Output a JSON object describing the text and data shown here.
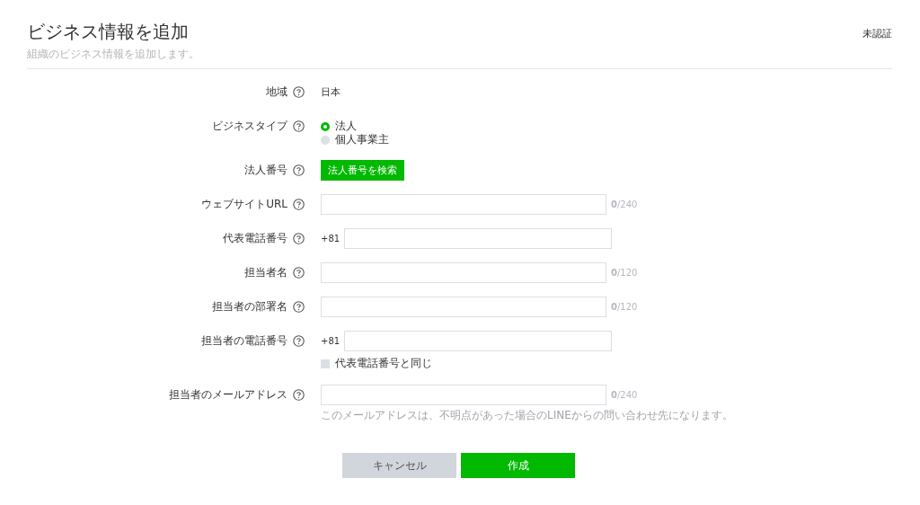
{
  "header": {
    "title": "ビジネス情報を追加",
    "subtitle": "組織のビジネス情報を追加します。",
    "status": "未認証"
  },
  "fields": [
    {
      "kind": "text",
      "label": "地域",
      "value": "日本"
    },
    {
      "kind": "radio",
      "label": "ビジネスタイプ",
      "options": [
        {
          "label": "法人",
          "selected": true
        },
        {
          "label": "個人事業主",
          "selected": false
        }
      ]
    },
    {
      "kind": "button",
      "label": "法人番号",
      "button": "法人番号を検索"
    },
    {
      "kind": "input",
      "label": "ウェブサイトURL",
      "counter": "**0**/240"
    },
    {
      "kind": "phone",
      "label": "代表電話番号",
      "prefix": "+81"
    },
    {
      "kind": "input",
      "label": "担当者名",
      "counter": "**0**/120"
    },
    {
      "kind": "input",
      "label": "担当者の部署名",
      "counter": "**0**/120"
    },
    {
      "kind": "phone",
      "label": "担当者の電話番号",
      "prefix": "+81",
      "checkbox": {
        "label": "代表電話番号と同じ",
        "checked": false
      }
    },
    {
      "kind": "input",
      "label": "担当者のメールアドレス",
      "counter": "**0**/240",
      "note": "このメールアドレスは、不明点があった場合のLINEからの問い合わせ先になります。"
    }
  ],
  "buttons": [
    {
      "kind": "cancel",
      "label": "キャンセル"
    },
    {
      "kind": "primary",
      "label": "作成"
    }
  ]
}
